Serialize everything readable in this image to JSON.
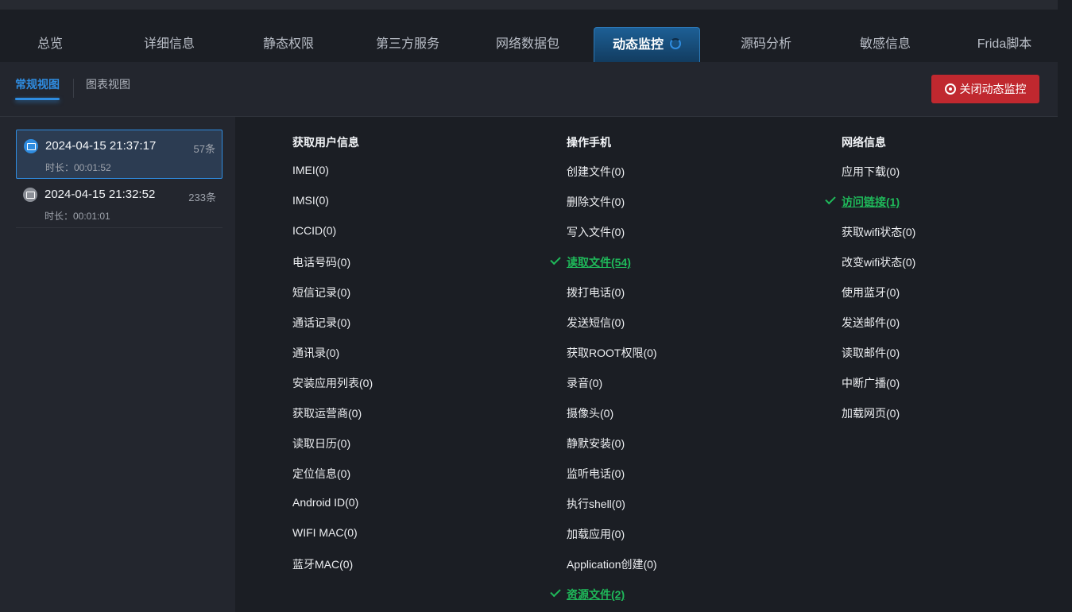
{
  "tabs": [
    "总览",
    "详细信息",
    "静态权限",
    "第三方服务",
    "网络数据包",
    "动态监控",
    "源码分析",
    "敏感信息",
    "Frida脚本"
  ],
  "view_tabs": {
    "regular": "常规视图",
    "chart": "图表视图"
  },
  "close_button": "关闭动态监控",
  "sessions": [
    {
      "time": "2024-04-15 21:37:17",
      "count": "57条",
      "duration": "时长：00:01:52"
    },
    {
      "time": "2024-04-15 21:32:52",
      "count": "233条",
      "duration": "时长：00:01:01"
    }
  ],
  "columns": [
    {
      "title": "获取用户信息",
      "items": [
        {
          "label": "IMEI(0)",
          "hit": false
        },
        {
          "label": "IMSI(0)",
          "hit": false
        },
        {
          "label": "ICCID(0)",
          "hit": false
        },
        {
          "label": "电话号码(0)",
          "hit": false
        },
        {
          "label": "短信记录(0)",
          "hit": false
        },
        {
          "label": "通话记录(0)",
          "hit": false
        },
        {
          "label": "通讯录(0)",
          "hit": false
        },
        {
          "label": "安装应用列表(0)",
          "hit": false
        },
        {
          "label": "获取运营商(0)",
          "hit": false
        },
        {
          "label": "读取日历(0)",
          "hit": false
        },
        {
          "label": "定位信息(0)",
          "hit": false
        },
        {
          "label": "Android ID(0)",
          "hit": false
        },
        {
          "label": "WIFI MAC(0)",
          "hit": false
        },
        {
          "label": "蓝牙MAC(0)",
          "hit": false
        }
      ]
    },
    {
      "title": "操作手机",
      "items": [
        {
          "label": "创建文件(0)",
          "hit": false
        },
        {
          "label": "删除文件(0)",
          "hit": false
        },
        {
          "label": "写入文件(0)",
          "hit": false
        },
        {
          "label": "读取文件(54)",
          "hit": true
        },
        {
          "label": "拨打电话(0)",
          "hit": false
        },
        {
          "label": "发送短信(0)",
          "hit": false
        },
        {
          "label": "获取ROOT权限(0)",
          "hit": false
        },
        {
          "label": "录音(0)",
          "hit": false
        },
        {
          "label": "摄像头(0)",
          "hit": false
        },
        {
          "label": "静默安装(0)",
          "hit": false
        },
        {
          "label": "监听电话(0)",
          "hit": false
        },
        {
          "label": "执行shell(0)",
          "hit": false
        },
        {
          "label": "加载应用(0)",
          "hit": false
        },
        {
          "label": "Application创建(0)",
          "hit": false
        },
        {
          "label": "资源文件(2)",
          "hit": true
        }
      ]
    },
    {
      "title": "网络信息",
      "items": [
        {
          "label": "应用下载(0)",
          "hit": false
        },
        {
          "label": "访问链接(1)",
          "hit": true
        },
        {
          "label": "获取wifi状态(0)",
          "hit": false
        },
        {
          "label": "改变wifi状态(0)",
          "hit": false
        },
        {
          "label": "使用蓝牙(0)",
          "hit": false
        },
        {
          "label": "发送邮件(0)",
          "hit": false
        },
        {
          "label": "读取邮件(0)",
          "hit": false
        },
        {
          "label": "中断广播(0)",
          "hit": false
        },
        {
          "label": "加载网页(0)",
          "hit": false
        }
      ]
    }
  ]
}
